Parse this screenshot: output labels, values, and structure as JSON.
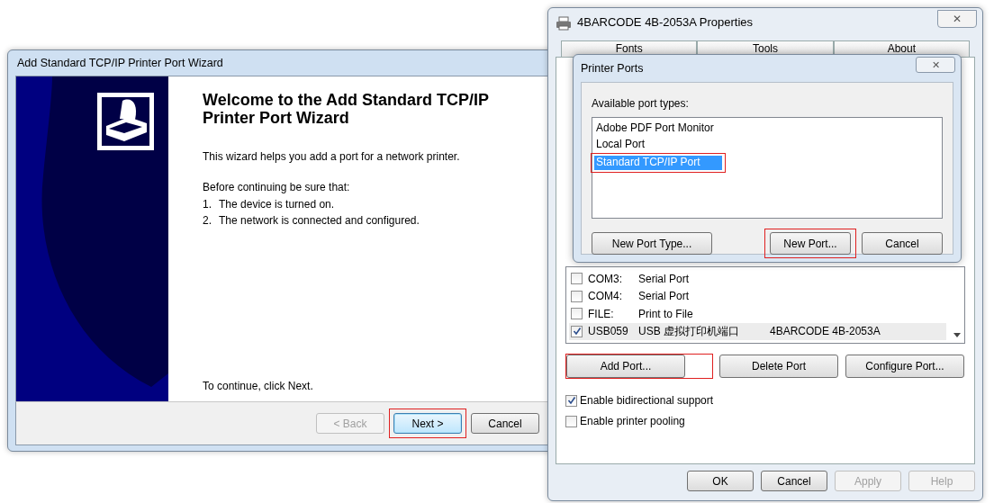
{
  "wizard": {
    "title": "Add Standard TCP/IP Printer Port Wizard",
    "heading": "Welcome to the Add Standard TCP/IP Printer Port Wizard",
    "intro": "This wizard helps you add a port for a network printer.",
    "checklist_intro": "Before continuing be sure that:",
    "steps": [
      {
        "number": "1.",
        "text": "The device is turned on."
      },
      {
        "number": "2.",
        "text": "The network is connected and configured."
      }
    ],
    "footer_text": "To continue, click Next.",
    "buttons": [
      {
        "label": "< Back",
        "disabled": true,
        "default": false,
        "highlighted": false
      },
      {
        "label": "Next >",
        "disabled": false,
        "default": true,
        "highlighted": true
      },
      {
        "label": "Cancel",
        "disabled": false,
        "default": false,
        "highlighted": false
      }
    ]
  },
  "properties": {
    "title": "4BARCODE 4B-2053A Properties",
    "close": "✕",
    "tabs": [
      "Fonts",
      "Tools",
      "About"
    ],
    "ports": [
      {
        "port": "COM3:",
        "description": "Serial Port",
        "checked": false,
        "selected": false
      },
      {
        "port": "COM4:",
        "description": "Serial Port",
        "checked": false,
        "selected": false
      },
      {
        "port": "FILE:",
        "description": "Print to File",
        "checked": false,
        "selected": false
      },
      {
        "port": "USB059",
        "description": "USB 虚拟打印机端口",
        "printer": "4BARCODE 4B-2053A",
        "checked": true,
        "selected": true
      }
    ],
    "port_buttons": [
      {
        "label": "Add Port...",
        "highlighted": true
      },
      {
        "label": "Delete Port",
        "highlighted": false
      },
      {
        "label": "Configure Port...",
        "highlighted": false
      }
    ],
    "options": [
      {
        "label": "Enable bidirectional support",
        "checked": true
      },
      {
        "label": "Enable printer pooling",
        "checked": false
      }
    ],
    "buttons": [
      {
        "label": "OK",
        "disabled": false
      },
      {
        "label": "Cancel",
        "disabled": false
      },
      {
        "label": "Apply",
        "disabled": true
      },
      {
        "label": "Help",
        "disabled": true
      }
    ]
  },
  "printer_ports_dialog": {
    "title": "Printer Ports",
    "close": "✕",
    "list_label": "Available port types:",
    "port_types": [
      {
        "label": "Adobe PDF Port Monitor",
        "selected": false,
        "highlighted": false
      },
      {
        "label": "Local Port",
        "selected": false,
        "highlighted": false
      },
      {
        "label": "Standard TCP/IP Port",
        "selected": true,
        "highlighted": true
      }
    ],
    "buttons": [
      {
        "label": "New Port Type...",
        "highlighted": false
      },
      {
        "label": "New Port...",
        "highlighted": true
      },
      {
        "label": "Cancel",
        "highlighted": false
      }
    ]
  }
}
